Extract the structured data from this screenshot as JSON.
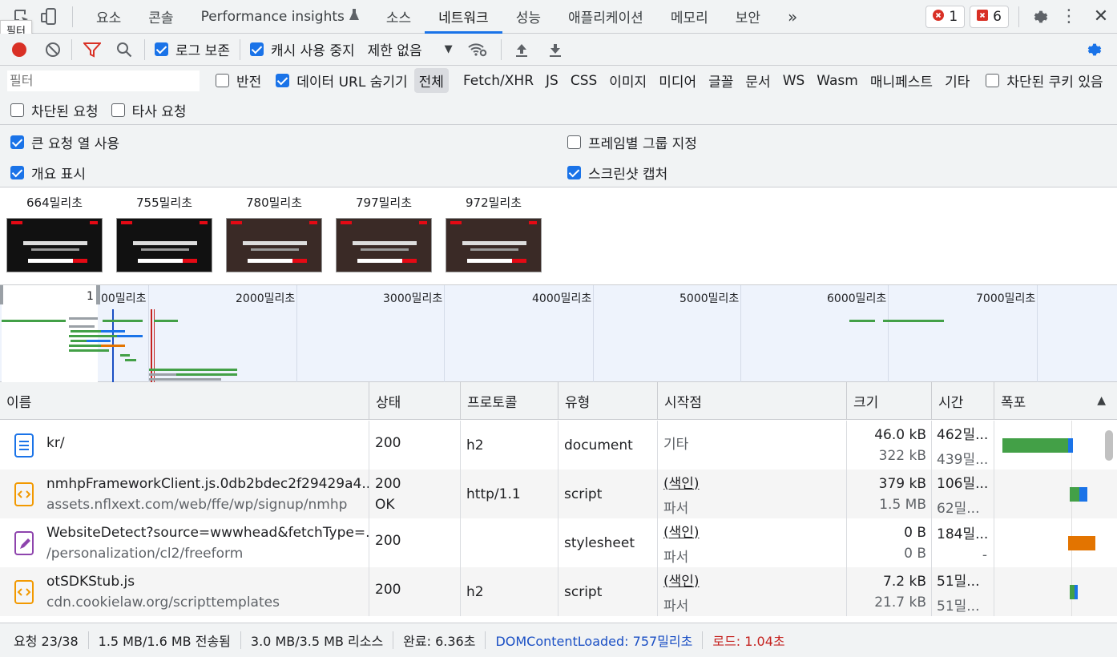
{
  "tooltip": "필터",
  "tabs": [
    "요소",
    "콘솔",
    "Performance insights",
    "소스",
    "네트워크",
    "성능",
    "애플리케이션",
    "메모리",
    "보안"
  ],
  "active_tab": "네트워크",
  "badges": {
    "errors": "1",
    "issues": "6"
  },
  "toolbar": {
    "preserve_log": "로그 보존",
    "disable_cache": "캐시 사용 중지",
    "throttle": "제한 없음"
  },
  "filter": {
    "placeholder": "필터",
    "invert": "반전",
    "hide_data_urls": "데이터 URL 숨기기",
    "types": [
      "전체",
      "Fetch/XHR",
      "JS",
      "CSS",
      "이미지",
      "미디어",
      "글꼴",
      "문서",
      "WS",
      "Wasm",
      "매니페스트",
      "기타"
    ],
    "blocked_cookies": "차단된 쿠키 있음",
    "blocked_requests": "차단된 요청",
    "third_party": "타사 요청"
  },
  "settings": {
    "big_rows": "큰 요청 열 사용",
    "group_by_frame": "프레임별 그룹 지정",
    "show_overview": "개요 표시",
    "capture_screenshots": "스크린샷 캡처"
  },
  "filmstrip": [
    "664밀리초",
    "755밀리초",
    "780밀리초",
    "797밀리초",
    "972밀리초"
  ],
  "overview_ticks": [
    "1",
    "00밀리초",
    "2000밀리초",
    "3000밀리초",
    "4000밀리초",
    "5000밀리초",
    "6000밀리초",
    "7000밀리초"
  ],
  "columns": [
    "이름",
    "상태",
    "프로토콜",
    "유형",
    "시작점",
    "크기",
    "시간",
    "폭포"
  ],
  "rows": [
    {
      "name": "kr/",
      "path": "",
      "status": "200",
      "status_text": "",
      "protocol": "h2",
      "type": "document",
      "initiator": "기타",
      "initiator_sub": "",
      "size": "46.0 kB",
      "resource": "322 kB",
      "time": "462밀...",
      "latency": "439밀...",
      "icon": "document-icon",
      "icon_color": "#1a73e8"
    },
    {
      "name": "nmhpFrameworkClient.js.0db2bdec2f29429a4...",
      "path": "assets.nflxext.com/web/ffe/wp/signup/nmhp",
      "status": "200",
      "status_text": "OK",
      "protocol": "http/1.1",
      "type": "script",
      "initiator": "(색인)",
      "initiator_sub": "파서",
      "size": "379 kB",
      "resource": "1.5 MB",
      "time": "106밀...",
      "latency": "62밀...",
      "icon": "script-icon",
      "icon_color": "#f29900"
    },
    {
      "name": "WebsiteDetect?source=wwwhead&fetchType=...",
      "path": "/personalization/cl2/freeform",
      "status": "200",
      "status_text": "",
      "protocol": "",
      "type": "stylesheet",
      "initiator": "(색인)",
      "initiator_sub": "파서",
      "size": "0 B",
      "resource": "0 B",
      "time": "184밀...",
      "latency": "-",
      "icon": "stylesheet-icon",
      "icon_color": "#8e44ad"
    },
    {
      "name": "otSDKStub.js",
      "path": "cdn.cookielaw.org/scripttemplates",
      "status": "200",
      "status_text": "",
      "protocol": "h2",
      "type": "script",
      "initiator": "(색인)",
      "initiator_sub": "파서",
      "size": "7.2 kB",
      "resource": "21.7 kB",
      "time": "51밀...",
      "latency": "51밀...",
      "icon": "script-icon",
      "icon_color": "#f29900"
    }
  ],
  "status_bar": {
    "requests": "요청 23/38",
    "transferred": "1.5 MB/1.6 MB 전송됨",
    "resources": "3.0 MB/3.5 MB 리소스",
    "finish": "완료: 6.36초",
    "dcl": "DOMContentLoaded: 757밀리초",
    "load": "로드: 1.04초",
    "dcl_color": "#1a4fc4",
    "load_color": "#c5221f"
  }
}
